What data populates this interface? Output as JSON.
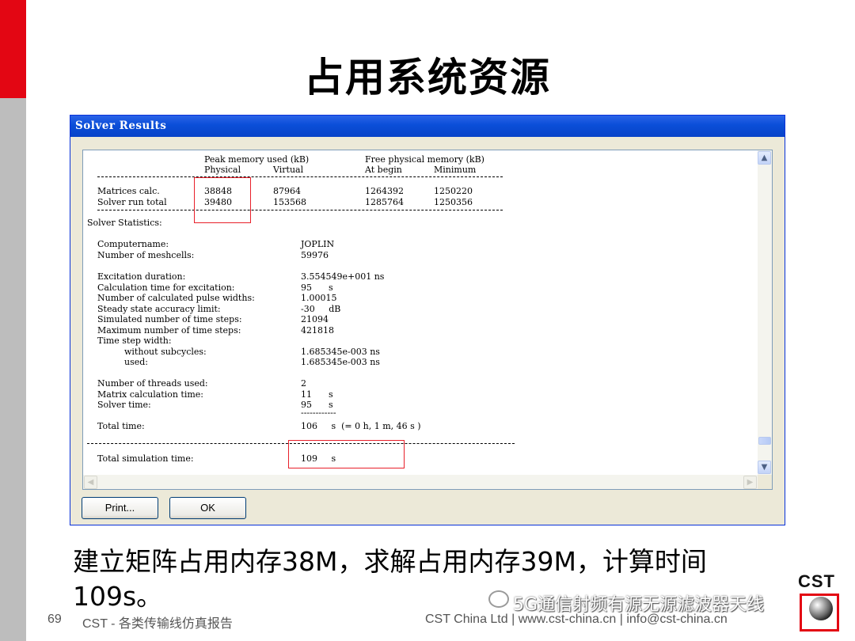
{
  "slide": {
    "title": "占用系统资源",
    "page_number": "69",
    "footer_left": "CST - 各类传输线仿真报告",
    "footer_right": "CST China Ltd | www.cst-china.cn | info@cst-china.cn",
    "caption_line1": "建立矩阵占用内存38M，求解占用内存39M，计算时间",
    "caption_line2": "109s。",
    "logo_text": "CST",
    "watermark": "5G通信射频有源无源滤波器天线"
  },
  "dialog": {
    "title": "Solver Results",
    "memory_table": {
      "group1_header": "Peak memory used (kB)",
      "group2_header": "Free physical memory (kB)",
      "col1": "Physical",
      "col2": "Virtual",
      "col3": "At begin",
      "col4": "Minimum",
      "rows": [
        {
          "label": "Matrices calc.",
          "physical": "38848",
          "virtual": "87964",
          "at_begin": "1264392",
          "minimum": "1250220"
        },
        {
          "label": "Solver run total",
          "physical": "39480",
          "virtual": "153568",
          "at_begin": "1285764",
          "minimum": "1250356"
        }
      ]
    },
    "stats_heading": "Solver Statistics:",
    "stats": [
      {
        "label": "Computername:",
        "value": "JOPLIN"
      },
      {
        "label": "Number of meshcells:",
        "value": "59976"
      },
      {
        "label": "Excitation duration:",
        "value": "3.554549e+001 ns"
      },
      {
        "label": "Calculation time for excitation:",
        "value": "95      s"
      },
      {
        "label": "Number of calculated pulse widths:",
        "value": "1.00015"
      },
      {
        "label": "Steady state accuracy limit:",
        "value": "-30     dB"
      },
      {
        "label": "Simulated number of time steps:",
        "value": "21094"
      },
      {
        "label": "Maximum number of time steps:",
        "value": "421818"
      },
      {
        "label": "Time step width:",
        "value": ""
      },
      {
        "label": "without subcycles:",
        "value": "1.685345e-003 ns"
      },
      {
        "label": "used:",
        "value": "1.685345e-003 ns"
      },
      {
        "label": "Number of threads used:",
        "value": "2"
      },
      {
        "label": "Matrix calculation time:",
        "value": "11      s"
      },
      {
        "label": "Solver time:",
        "value": "95      s"
      },
      {
        "label": "Total time:",
        "value": "106     s  (= 0 h, 1 m, 46 s )"
      }
    ],
    "separator": "------------",
    "total_sim_label": "Total simulation time:",
    "total_sim_value": "109     s",
    "buttons": {
      "print": "Print...",
      "ok": "OK"
    },
    "accent_color": "#0a4ed8",
    "highlight_color": "#e8202a"
  }
}
